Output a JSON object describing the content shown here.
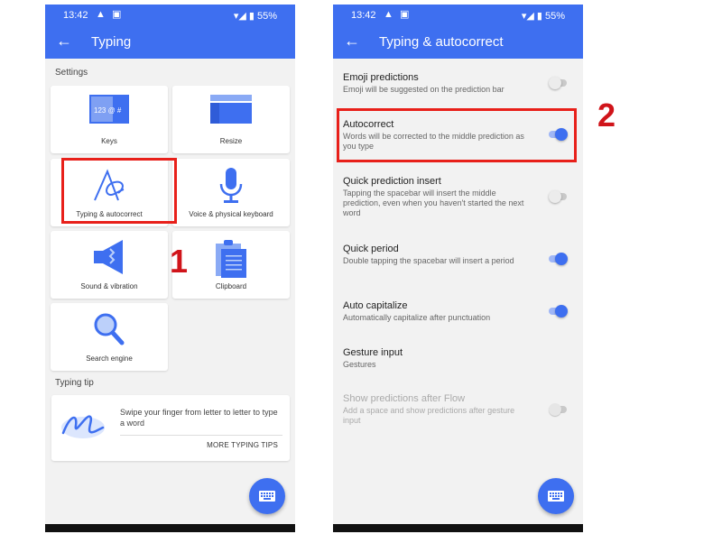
{
  "status_bar": {
    "time": "13:42",
    "battery": "55%",
    "icons": "▲ ▣",
    "signal": "▾◢ ▮"
  },
  "left_screen": {
    "title": "Typing",
    "settings_label": "Settings",
    "tiles": [
      {
        "label": "Keys",
        "icon": "keys-icon"
      },
      {
        "label": "Resize",
        "icon": "resize-icon"
      },
      {
        "label": "Typing & autocorrect",
        "icon": "typing-icon"
      },
      {
        "label": "Voice & physical keyboard",
        "icon": "microphone-icon"
      },
      {
        "label": "Sound & vibration",
        "icon": "speaker-icon"
      },
      {
        "label": "Clipboard",
        "icon": "clipboard-icon"
      },
      {
        "label": "Search engine",
        "icon": "search-icon"
      }
    ],
    "keys_icon_text": "123 @ #",
    "tip_label": "Typing tip",
    "tip_text": "Swipe your finger from letter to letter to type a word",
    "tip_link": "MORE TYPING TIPS"
  },
  "right_screen": {
    "title": "Typing & autocorrect",
    "settings": [
      {
        "title": "Emoji predictions",
        "subtitle": "Emoji will be suggested on the prediction bar",
        "toggle": false,
        "enabled": true
      },
      {
        "title": "Autocorrect",
        "subtitle": "Words will be corrected to the middle prediction as you type",
        "toggle": true,
        "enabled": true
      },
      {
        "title": "Quick prediction insert",
        "subtitle": "Tapping the spacebar will insert the middle prediction, even when you haven't started the next word",
        "toggle": false,
        "enabled": true
      },
      {
        "title": "Quick period",
        "subtitle": "Double tapping the spacebar will insert a period",
        "toggle": true,
        "enabled": true
      },
      {
        "title": "Auto capitalize",
        "subtitle": "Automatically capitalize after punctuation",
        "toggle": true,
        "enabled": true
      },
      {
        "title": "Gesture input",
        "subtitle": "Gestures"
      },
      {
        "title": "Show predictions after Flow",
        "subtitle": "Add a space and show predictions after gesture input",
        "toggle": false,
        "enabled": false
      }
    ]
  },
  "markers": {
    "step1": "1",
    "step2": "2"
  },
  "colors": {
    "accent": "#3e6ff0",
    "highlight": "#e8201a",
    "marker": "#d0141a"
  }
}
